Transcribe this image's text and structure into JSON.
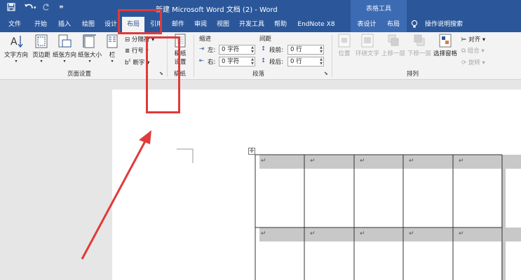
{
  "titlebar": {
    "doc_title": "新建 Microsoft Word 文档 (2)  -  Word",
    "context_title": "表格工具",
    "save_icon": "save-icon",
    "undo_icon": "undo-icon",
    "redo_icon": "redo-icon",
    "customize_icon": "customize-qat-icon"
  },
  "tabs": [
    {
      "label": "文件",
      "active": false
    },
    {
      "label": "开始",
      "active": false
    },
    {
      "label": "插入",
      "active": false
    },
    {
      "label": "绘图",
      "active": false
    },
    {
      "label": "设计",
      "active": false
    },
    {
      "label": "布局",
      "active": true
    },
    {
      "label": "引用",
      "active": false
    },
    {
      "label": "邮件",
      "active": false
    },
    {
      "label": "审阅",
      "active": false
    },
    {
      "label": "视图",
      "active": false
    },
    {
      "label": "开发工具",
      "active": false
    },
    {
      "label": "帮助",
      "active": false
    },
    {
      "label": "EndNote X8",
      "active": false
    },
    {
      "label": "表设计",
      "active": false
    },
    {
      "label": "布局",
      "active": false
    }
  ],
  "tell_me": "操作说明搜索",
  "page_setup": {
    "label": "页面设置",
    "text_direction": "文字方向",
    "margins": "页边距",
    "orientation": "纸张方向",
    "size": "纸张大小",
    "columns": "栏",
    "breaks": "分隔符",
    "line_numbers": "行号",
    "hyphenation": "断字"
  },
  "manuscript": {
    "label": "稿纸",
    "btn_line1": "稿纸",
    "btn_line2": "设置"
  },
  "paragraph": {
    "label": "段落",
    "indent_title": "缩进",
    "spacing_title": "间距",
    "left_label": "左:",
    "right_label": "右:",
    "left_value": "0 字符",
    "right_value": "0 字符",
    "before_label": "段前:",
    "after_label": "段后:",
    "before_value": "0 行",
    "after_value": "0 行"
  },
  "arrange": {
    "label": "排列",
    "position": "位置",
    "wrap_text": "环绕文字",
    "bring_forward": "上移一层",
    "send_backward": "下移一层",
    "selection_pane": "选择窗格",
    "align": "对齐",
    "group": "组合",
    "rotate": "旋转"
  },
  "document": {
    "cell_mark": "↵"
  },
  "colors": {
    "word_blue": "#2b579a",
    "annotation_red": "#e03a3a",
    "table_row_shade": "#c8c8c8"
  }
}
